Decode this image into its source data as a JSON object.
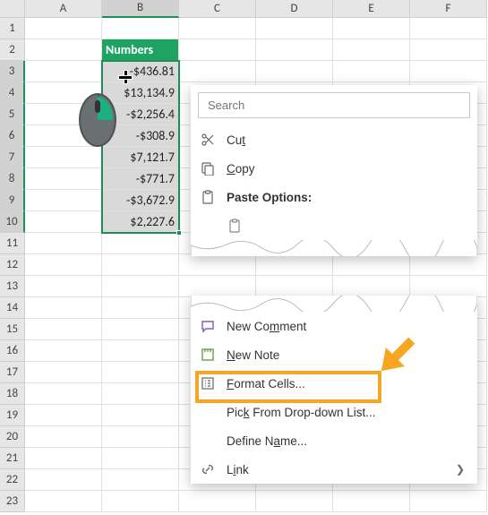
{
  "columns": [
    "A",
    "B",
    "C",
    "D",
    "E",
    "F"
  ],
  "rows": [
    "1",
    "2",
    "3",
    "4",
    "5",
    "6",
    "7",
    "8",
    "9",
    "10",
    "11",
    "12",
    "13",
    "14",
    "15",
    "16",
    "17",
    "18",
    "19",
    "20",
    "21",
    "22",
    "23"
  ],
  "data_header": "Numbers",
  "data_values": [
    "-$436.81",
    "$13,134.9",
    "-$2,256.4",
    "-$308.9",
    "$7,121.7",
    "-$771.7",
    "-$3,672.9",
    "$2,227.6"
  ],
  "search_placeholder": "Search",
  "menu": {
    "cut": "Cut",
    "copy": "Copy",
    "paste_options": "Paste Options:",
    "new_comment": "New Comment",
    "new_note": "New Note",
    "format_cells": "Format Cells...",
    "pick_list": "Pick From Drop-down List...",
    "define_name": "Define Name...",
    "link": "Link"
  },
  "menu_underline": {
    "cut": "t",
    "copy": "C",
    "new_comment": "M",
    "new_note": "N",
    "format_cells": "F",
    "pick_list": "K",
    "define_name": "A",
    "link": "i"
  },
  "selection": {
    "col": "B",
    "row_start": 3,
    "row_end": 10
  },
  "colors": {
    "accent": "#1ea362",
    "highlight": "#f5a623"
  }
}
